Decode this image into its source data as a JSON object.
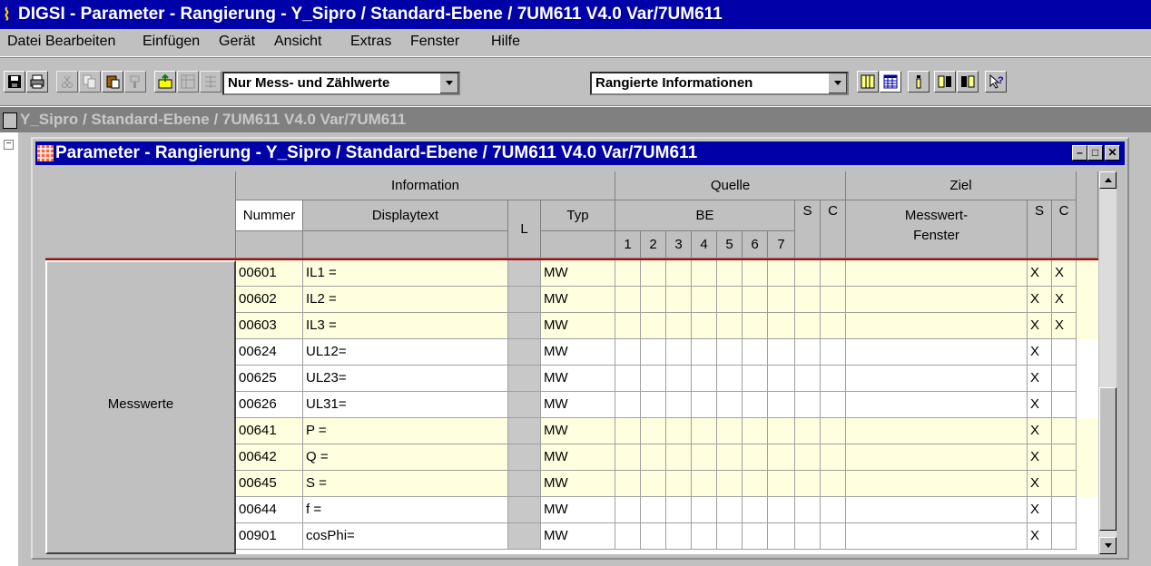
{
  "app": {
    "title": "DIGSI - Parameter - Rangierung - Y_Sipro / Standard-Ebene / 7UM611 V4.0 Var/7UM611"
  },
  "menu": [
    {
      "label": "Datei"
    },
    {
      "label": "Bearbeiten"
    },
    {
      "label": "Einfügen"
    },
    {
      "label": "Gerät"
    },
    {
      "label": "Ansicht"
    },
    {
      "label": "Extras"
    },
    {
      "label": "Fenster"
    },
    {
      "label": "Hilfe"
    }
  ],
  "toolbar": {
    "filter_select": "Nur Mess- und Zählwerte",
    "view_select": "Rangierte Informationen",
    "icons": [
      "save-icon",
      "print-icon",
      "cut-icon",
      "copy-icon",
      "paste-icon",
      "format-painter-icon",
      "insert-icon",
      "pivot-icon",
      "sort-icon",
      "columns-icon",
      "table-icon",
      "info-icon",
      "filter-icon",
      "filter2-icon",
      "help-icon"
    ]
  },
  "child_window": {
    "title": "Y_Sipro / Standard-Ebene / 7UM611 V4.0 Var/7UM611"
  },
  "matrix_window": {
    "title": "Parameter - Rangierung - Y_Sipro / Standard-Ebene / 7UM611 V4.0 Var/7UM611",
    "header": {
      "information": "Information",
      "quelle": "Quelle",
      "ziel": "Ziel",
      "nummer": "Nummer",
      "displaytext": "Displaytext",
      "l": "L",
      "typ": "Typ",
      "be": "BE",
      "s": "S",
      "c": "C",
      "be_cols": [
        "1",
        "2",
        "3",
        "4",
        "5",
        "6",
        "7"
      ],
      "messwert_fenster": "Messwert-\nFenster"
    },
    "group_label": "Messwerte",
    "rows": [
      {
        "nummer": "00601",
        "text": "IL1 =",
        "typ": "MW",
        "s": "X",
        "c": "X",
        "highlight": true
      },
      {
        "nummer": "00602",
        "text": "IL2 =",
        "typ": "MW",
        "s": "X",
        "c": "X",
        "highlight": true
      },
      {
        "nummer": "00603",
        "text": "IL3 =",
        "typ": "MW",
        "s": "X",
        "c": "X",
        "highlight": true
      },
      {
        "nummer": "00624",
        "text": "UL12=",
        "typ": "MW",
        "s": "X",
        "c": "",
        "highlight": false
      },
      {
        "nummer": "00625",
        "text": "UL23=",
        "typ": "MW",
        "s": "X",
        "c": "",
        "highlight": false
      },
      {
        "nummer": "00626",
        "text": "UL31=",
        "typ": "MW",
        "s": "X",
        "c": "",
        "highlight": false
      },
      {
        "nummer": "00641",
        "text": "P  =",
        "typ": "MW",
        "s": "X",
        "c": "",
        "highlight": true
      },
      {
        "nummer": "00642",
        "text": "Q  =",
        "typ": "MW",
        "s": "X",
        "c": "",
        "highlight": true
      },
      {
        "nummer": "00645",
        "text": "S  =",
        "typ": "MW",
        "s": "X",
        "c": "",
        "highlight": true
      },
      {
        "nummer": "00644",
        "text": "f  =",
        "typ": "MW",
        "s": "X",
        "c": "",
        "highlight": false
      },
      {
        "nummer": "00901",
        "text": "cosPhi=",
        "typ": "MW",
        "s": "X",
        "c": "",
        "highlight": false
      }
    ]
  }
}
